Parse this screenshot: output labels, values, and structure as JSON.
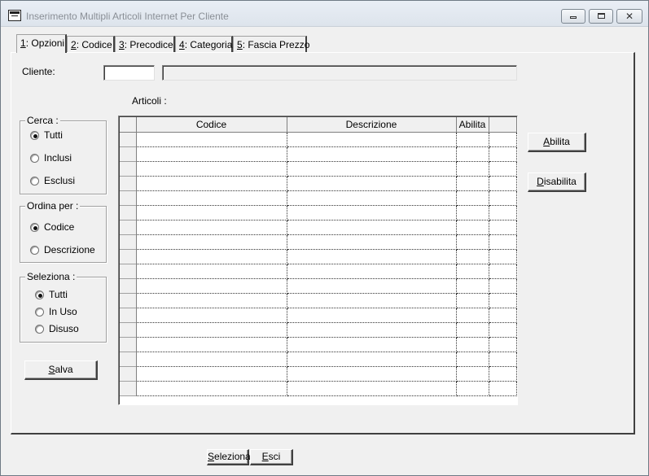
{
  "window": {
    "title": "Inserimento Multipli Articoli Internet Per Cliente"
  },
  "tabs": [
    {
      "key": "1",
      "label": ": Opzioni",
      "active": true
    },
    {
      "key": "2",
      "label": ": Codice"
    },
    {
      "key": "3",
      "label": ": Precodice"
    },
    {
      "key": "4",
      "label": ": Categoria"
    },
    {
      "key": "5",
      "label": ": Fascia Prezzo"
    }
  ],
  "cliente": {
    "label": "Cliente:",
    "code_value": "",
    "name_value": ""
  },
  "articoli_label": "Articoli :",
  "cerca": {
    "title": "Cerca :",
    "options": [
      "Tutti",
      "Inclusi",
      "Esclusi"
    ],
    "selected": "Tutti"
  },
  "ordina": {
    "title": "Ordina per :",
    "options": [
      "Codice",
      "Descrizione"
    ],
    "selected": "Codice"
  },
  "seleziona": {
    "title": "Seleziona :",
    "options": [
      "Tutti",
      "In Uso",
      "Disuso"
    ],
    "selected": "Tutti"
  },
  "buttons": {
    "salva": {
      "mn": "S",
      "rest": "alva"
    },
    "abilita": {
      "mn": "A",
      "rest": "bilita"
    },
    "disabilita": {
      "mn": "D",
      "rest": "isabilita"
    },
    "seleziona": {
      "mn": "S",
      "rest": "eleziona"
    },
    "esci": {
      "mn": "E",
      "rest": "sci"
    }
  },
  "grid": {
    "columns": [
      "Codice",
      "Descrizione",
      "Abilita",
      ""
    ],
    "row_count": 18
  }
}
